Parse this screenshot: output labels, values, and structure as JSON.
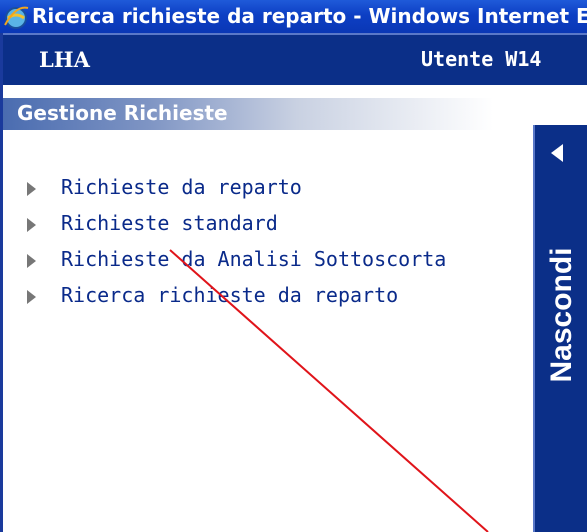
{
  "window": {
    "title": "Ricerca richieste da reparto - Windows Internet Explorer",
    "icon": "ie-icon"
  },
  "header": {
    "app_name": "LHA",
    "user_label": "Utente W14"
  },
  "panel": {
    "title": "Gestione Richieste"
  },
  "menu": {
    "items": [
      {
        "label": "Richieste da reparto",
        "icon": "triangle-right-icon"
      },
      {
        "label": "Richieste standard",
        "icon": "triangle-right-icon"
      },
      {
        "label": "Richieste da Analisi Sottoscorta",
        "icon": "triangle-right-icon"
      },
      {
        "label": "Ricerca richieste da reparto",
        "icon": "triangle-right-icon"
      }
    ]
  },
  "sidebar": {
    "label": "Nascondi",
    "icon": "arrow-left-icon"
  },
  "colors": {
    "titlebar": "#0d3fc4",
    "header_bg": "#0b2f88",
    "link": "#0a2a8a",
    "annotation": "#e0141a"
  }
}
